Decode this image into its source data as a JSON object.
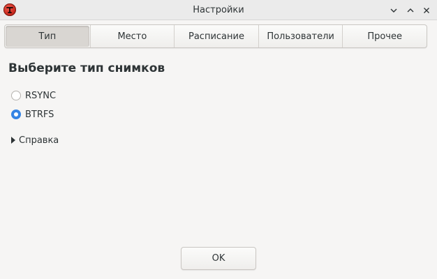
{
  "window": {
    "title": "Настройки",
    "app_icon": "timeshift-icon",
    "controls": [
      "minimize-icon",
      "maximize-icon",
      "close-icon"
    ]
  },
  "tabs": [
    {
      "label": "Тип",
      "active": true
    },
    {
      "label": "Место",
      "active": false
    },
    {
      "label": "Расписание",
      "active": false
    },
    {
      "label": "Пользователи",
      "active": false
    },
    {
      "label": "Прочее",
      "active": false
    }
  ],
  "content": {
    "heading": "Выберите тип снимков",
    "options": [
      {
        "label": "RSYNC",
        "checked": false
      },
      {
        "label": "BTRFS",
        "checked": true
      }
    ],
    "help_expander": "Справка"
  },
  "footer": {
    "ok_label": "OK"
  },
  "colors": {
    "accent": "#3584e4",
    "app_icon": "#d8342a",
    "background": "#f6f5f4",
    "titlebar": "#ebebeb"
  }
}
